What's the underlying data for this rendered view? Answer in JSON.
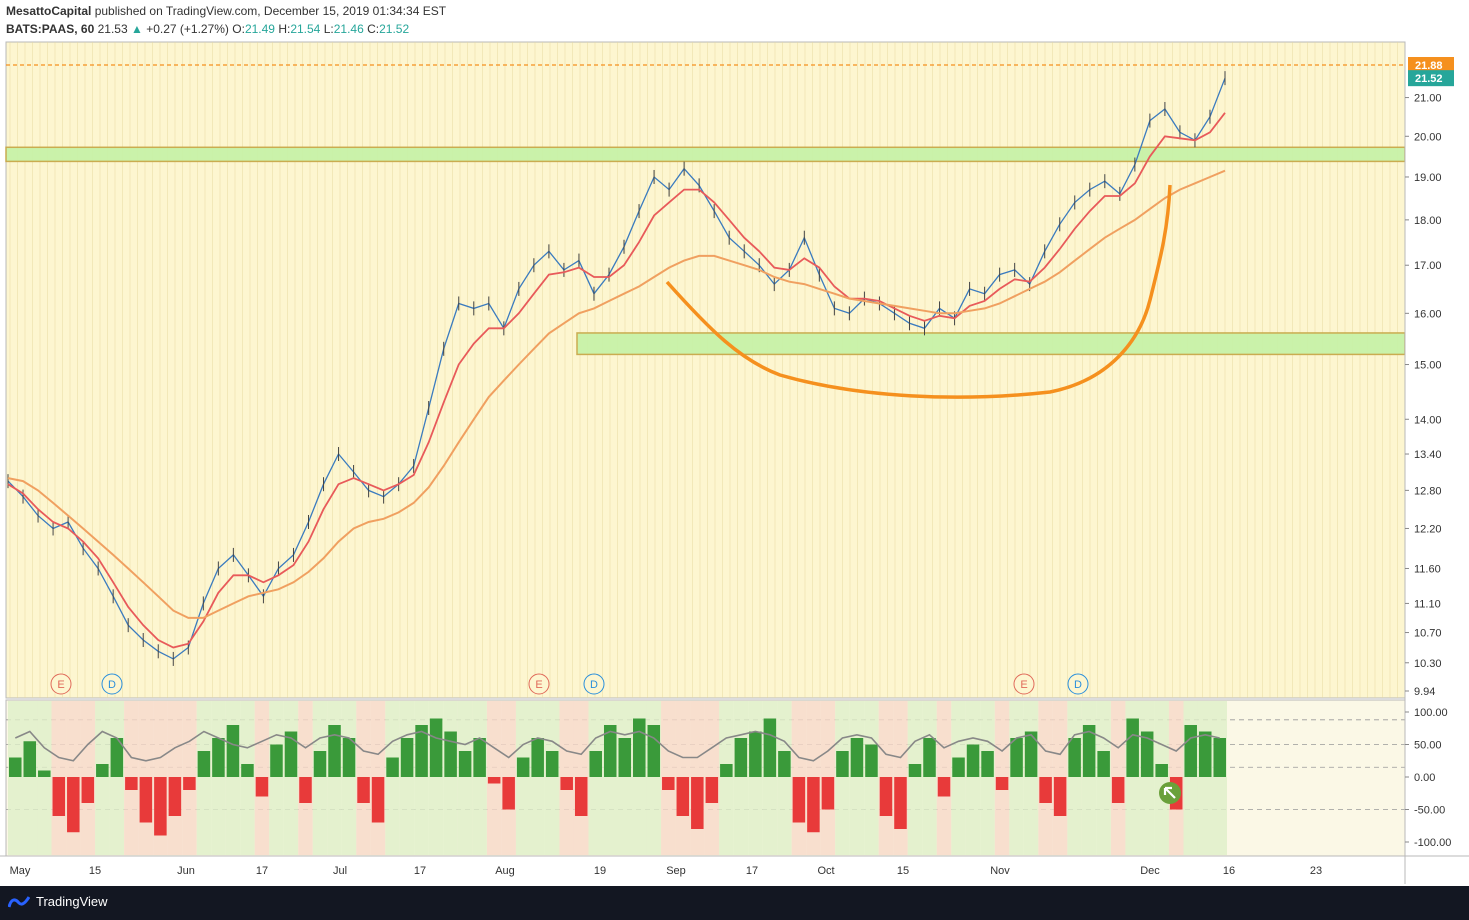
{
  "header": {
    "author": "MesattoCapital",
    "published": "published on TradingView.com, December 15, 2019 01:34:34 EST",
    "symbol": "BATS:PAAS, 60",
    "last": "21.53",
    "change": "+0.27 (+1.27%)",
    "o_label": "O:",
    "o": "21.49",
    "h_label": "H:",
    "h": "21.54",
    "l_label": "L:",
    "l": "21.46",
    "c_label": "C:",
    "c": "21.52"
  },
  "footer": {
    "brand": "TradingView"
  },
  "colors": {
    "panel_bg": "#fdf6d0",
    "grid": "#e8d9a0",
    "zone_fill": "#c8f2a8",
    "zone_border": "#c8a94a",
    "curve": "#f5901e",
    "ma_fast": "#e85a5a",
    "ma_slow": "#f0a060",
    "osc_up": "#3a9a3a",
    "osc_down": "#e83a3a",
    "osc_line": "#888888",
    "price_label": "#26a69a",
    "level_label": "#f5901e"
  },
  "chart_data": [
    {
      "type": "line",
      "title": "",
      "price_scale": "log",
      "ylim": [
        9.94,
        21.88
      ],
      "y_ticks": [
        "21.00",
        "20.00",
        "19.00",
        "18.00",
        "17.00",
        "16.00",
        "15.00",
        "14.00",
        "13.40",
        "12.80",
        "12.20",
        "11.60",
        "11.10",
        "10.70",
        "10.30",
        "9.94"
      ],
      "current_price_label": "21.52",
      "level_label": "21.88",
      "x_ticks": [
        "May",
        "15",
        "Jun",
        "17",
        "Jul",
        "17",
        "Aug",
        "19",
        "Sep",
        "17",
        "Oct",
        "15",
        "Nov",
        "Dec",
        "16",
        "23"
      ],
      "events": [
        {
          "label": "E",
          "date": "May 7"
        },
        {
          "label": "D",
          "date": "May 17"
        },
        {
          "label": "E",
          "date": "Aug 7"
        },
        {
          "label": "D",
          "date": "Aug 18"
        },
        {
          "label": "E",
          "date": "Nov 6"
        },
        {
          "label": "D",
          "date": "Nov 17"
        }
      ],
      "zones": [
        {
          "name": "resistance",
          "low": 19.45,
          "high": 19.65
        },
        {
          "name": "support",
          "low": 15.25,
          "high": 15.55
        }
      ],
      "series": [
        {
          "values": [
            12.95,
            12.7,
            12.4,
            12.2,
            12.3,
            11.9,
            11.6,
            11.2,
            10.8,
            10.6,
            10.45,
            10.35,
            10.5,
            11.1,
            11.6,
            11.8,
            11.5,
            11.2,
            11.6,
            11.8,
            12.3,
            12.9,
            13.4,
            13.1,
            12.8,
            12.7,
            12.9,
            13.2,
            14.2,
            15.3,
            16.2,
            16.1,
            16.2,
            15.7,
            16.5,
            17.0,
            17.3,
            16.9,
            17.1,
            16.4,
            16.8,
            17.4,
            18.2,
            19.0,
            18.7,
            19.2,
            18.8,
            18.2,
            17.6,
            17.3,
            17.0,
            16.6,
            16.9,
            17.6,
            16.8,
            16.1,
            16.0,
            16.3,
            16.2,
            16.0,
            15.8,
            15.7,
            16.1,
            15.9,
            16.5,
            16.4,
            16.8,
            16.9,
            16.6,
            17.3,
            17.9,
            18.4,
            18.7,
            18.9,
            18.6,
            19.3,
            20.4,
            20.7,
            20.1,
            19.9,
            20.5,
            21.52
          ]
        },
        {
          "values": [
            12.9,
            12.75,
            12.5,
            12.3,
            12.2,
            12.0,
            11.75,
            11.4,
            11.05,
            10.8,
            10.6,
            10.5,
            10.55,
            10.85,
            11.25,
            11.5,
            11.5,
            11.4,
            11.5,
            11.65,
            12.0,
            12.5,
            12.9,
            13.0,
            12.9,
            12.8,
            12.9,
            13.05,
            13.6,
            14.3,
            15.0,
            15.4,
            15.7,
            15.7,
            16.0,
            16.4,
            16.8,
            16.85,
            16.95,
            16.75,
            16.75,
            17.0,
            17.5,
            18.1,
            18.4,
            18.7,
            18.7,
            18.4,
            18.0,
            17.6,
            17.3,
            16.95,
            16.9,
            17.15,
            16.95,
            16.55,
            16.3,
            16.3,
            16.25,
            16.1,
            15.95,
            15.85,
            15.95,
            15.9,
            16.15,
            16.25,
            16.5,
            16.7,
            16.65,
            16.95,
            17.35,
            17.8,
            18.2,
            18.55,
            18.55,
            18.85,
            19.5,
            20.0,
            19.95,
            19.9,
            20.1,
            20.6
          ]
        },
        {
          "values": [
            13.0,
            12.95,
            12.8,
            12.6,
            12.4,
            12.2,
            12.0,
            11.8,
            11.6,
            11.4,
            11.2,
            11.0,
            10.9,
            10.9,
            11.0,
            11.1,
            11.2,
            11.25,
            11.3,
            11.4,
            11.55,
            11.75,
            12.0,
            12.2,
            12.3,
            12.35,
            12.45,
            12.6,
            12.85,
            13.2,
            13.6,
            14.0,
            14.4,
            14.7,
            15.0,
            15.3,
            15.6,
            15.8,
            16.0,
            16.1,
            16.25,
            16.4,
            16.55,
            16.75,
            16.95,
            17.1,
            17.2,
            17.2,
            17.1,
            17.0,
            16.9,
            16.75,
            16.65,
            16.6,
            16.5,
            16.4,
            16.3,
            16.25,
            16.2,
            16.15,
            16.1,
            16.05,
            16.0,
            16.0,
            16.05,
            16.1,
            16.2,
            16.35,
            16.5,
            16.65,
            16.85,
            17.1,
            17.35,
            17.6,
            17.8,
            18.0,
            18.25,
            18.5,
            18.7,
            18.85,
            19.0,
            19.15
          ]
        }
      ]
    },
    {
      "type": "area",
      "title": "",
      "ylim": [
        -110,
        110
      ],
      "y_ticks": [
        "100.00",
        "50.00",
        "0.00",
        "-50.00",
        "-100.00"
      ],
      "series": [
        {
          "values": [
            30,
            55,
            10,
            -60,
            -85,
            -40,
            20,
            60,
            -20,
            -70,
            -90,
            -60,
            -20,
            40,
            60,
            80,
            20,
            -30,
            50,
            70,
            -40,
            40,
            80,
            60,
            -40,
            -70,
            30,
            60,
            80,
            90,
            70,
            40,
            60,
            -10,
            -50,
            30,
            60,
            40,
            -20,
            -60,
            40,
            80,
            60,
            90,
            80,
            -20,
            -60,
            -80,
            -40,
            20,
            60,
            70,
            90,
            40,
            -70,
            -85,
            -50,
            40,
            60,
            50,
            -60,
            -80,
            20,
            60,
            -30,
            30,
            50,
            40,
            -20,
            60,
            70,
            -40,
            -60,
            60,
            80,
            40,
            -40,
            90,
            70,
            20,
            -50,
            80,
            70,
            60
          ]
        },
        {
          "values": [
            60,
            70,
            45,
            30,
            25,
            50,
            70,
            60,
            30,
            25,
            30,
            45,
            55,
            70,
            60,
            50,
            45,
            55,
            65,
            60,
            45,
            60,
            65,
            60,
            40,
            35,
            55,
            65,
            70,
            60,
            55,
            50,
            60,
            45,
            30,
            50,
            60,
            55,
            40,
            35,
            60,
            70,
            65,
            70,
            60,
            40,
            30,
            30,
            45,
            60,
            65,
            70,
            65,
            55,
            30,
            25,
            40,
            60,
            65,
            60,
            35,
            30,
            55,
            65,
            45,
            55,
            60,
            55,
            40,
            60,
            65,
            40,
            35,
            65,
            70,
            60,
            45,
            65,
            60,
            50,
            40,
            60,
            65,
            60
          ]
        }
      ],
      "x_ticks": [
        "May",
        "15",
        "Jun",
        "17",
        "Jul",
        "17",
        "Aug",
        "19",
        "Sep",
        "17",
        "Oct",
        "15",
        "Nov",
        "Dec",
        "16",
        "23"
      ],
      "annotation": "up-left arrow near 0 line in early December"
    }
  ]
}
